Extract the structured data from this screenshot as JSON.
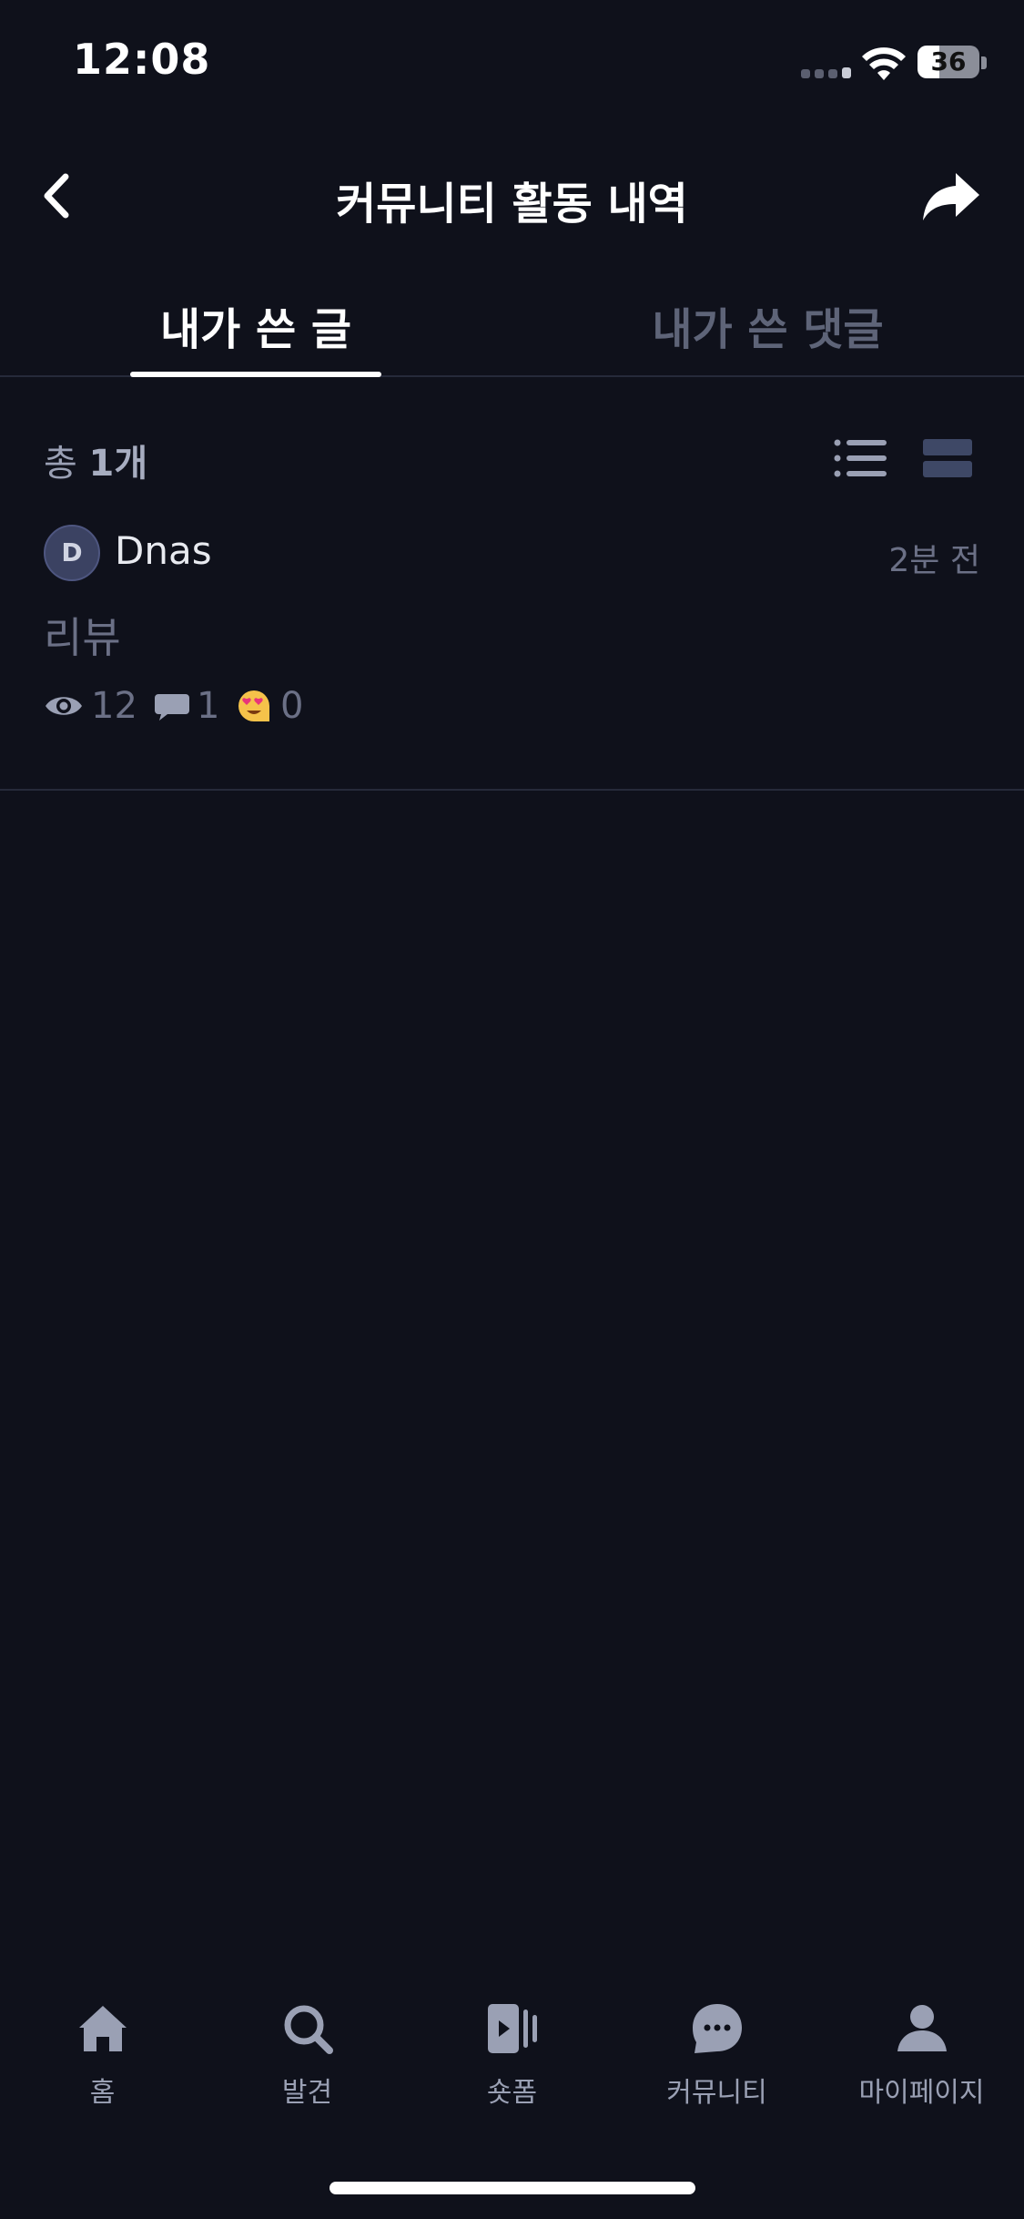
{
  "status_bar": {
    "time": "12:08",
    "battery_level": "36",
    "battery_fraction": 0.36
  },
  "header": {
    "title": "커뮤니티 활동 내역",
    "back_icon": "chevron-left-icon",
    "share_icon": "share-arrow-icon"
  },
  "tabs": [
    {
      "label": "내가 쓴 글",
      "active": true
    },
    {
      "label": "내가 쓴 댓글",
      "active": false
    }
  ],
  "list": {
    "count_prefix": "총 ",
    "count_value": "1개",
    "view_list_icon": "list-view-icon",
    "view_card_icon": "card-view-icon"
  },
  "posts": [
    {
      "avatar_initial": "D",
      "author": "Dnas",
      "time": "2분 전",
      "title": "리뷰",
      "views": "12",
      "comments": "1",
      "reactions": "0"
    }
  ],
  "bottom_nav": [
    {
      "label": "홈",
      "icon": "home-icon"
    },
    {
      "label": "발견",
      "icon": "search-icon"
    },
    {
      "label": "숏폼",
      "icon": "shortform-video-icon"
    },
    {
      "label": "커뮤니티",
      "icon": "chat-bubble-icon"
    },
    {
      "label": "마이페이지",
      "icon": "person-icon"
    }
  ],
  "colors": {
    "background": "#0f111b",
    "text_primary": "#ffffff",
    "text_muted": "#6b7086",
    "tab_inactive": "#5e6478",
    "divider": "#262a3a",
    "nav_icon": "#9aa0b4"
  }
}
